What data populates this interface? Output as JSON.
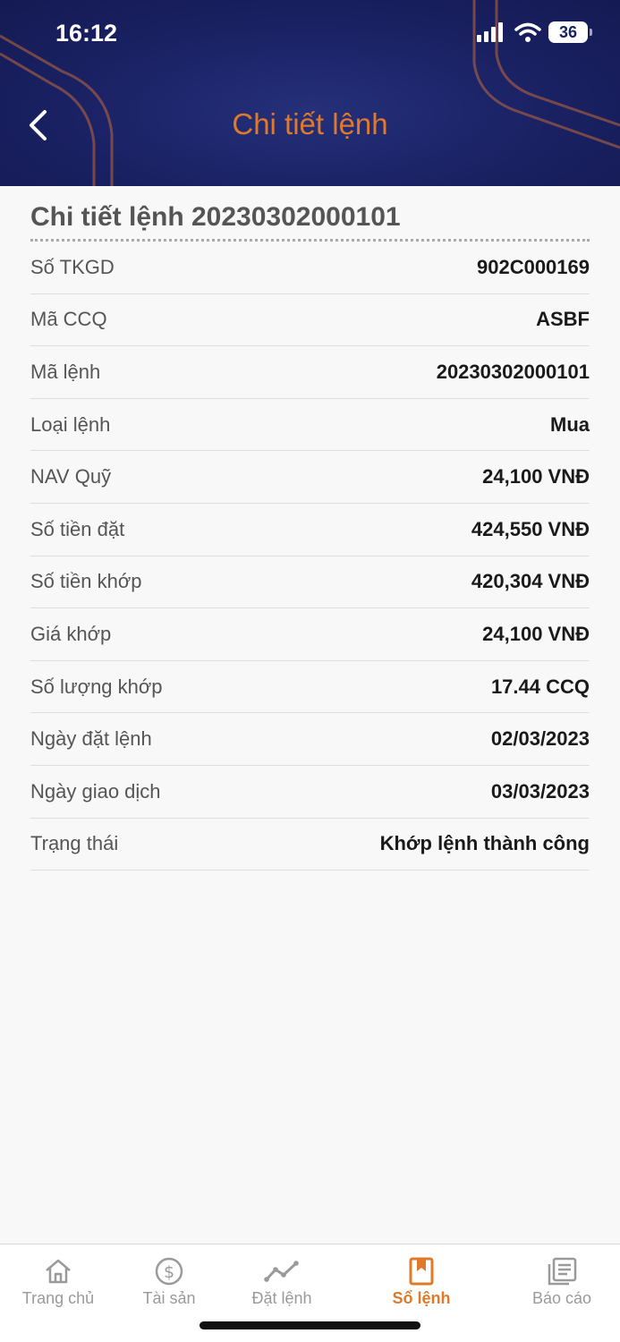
{
  "status": {
    "time": "16:12",
    "battery": "36"
  },
  "header": {
    "title": "Chi tiết lệnh"
  },
  "section": {
    "title": "Chi tiết lệnh 20230302000101"
  },
  "details": [
    {
      "label": "Số TKGD",
      "value": "902C000169"
    },
    {
      "label": "Mã CCQ",
      "value": "ASBF"
    },
    {
      "label": "Mã lệnh",
      "value": "20230302000101"
    },
    {
      "label": "Loại lệnh",
      "value": "Mua"
    },
    {
      "label": "NAV Quỹ",
      "value": "24,100 VNĐ"
    },
    {
      "label": "Số tiền đặt",
      "value": "424,550 VNĐ"
    },
    {
      "label": "Số tiền khớp",
      "value": "420,304 VNĐ"
    },
    {
      "label": "Giá khớp",
      "value": "24,100 VNĐ"
    },
    {
      "label": "Số lượng khớp",
      "value": "17.44 CCQ"
    },
    {
      "label": "Ngày đặt lệnh",
      "value": "02/03/2023"
    },
    {
      "label": "Ngày giao dịch",
      "value": "03/03/2023"
    },
    {
      "label": "Trạng thái",
      "value": "Khớp lệnh thành công"
    }
  ],
  "tabs": [
    {
      "label": "Trang chủ",
      "icon": "home-icon"
    },
    {
      "label": "Tài sản",
      "icon": "dollar-icon"
    },
    {
      "label": "Đặt lệnh",
      "icon": "chart-line-icon"
    },
    {
      "label": "Sổ lệnh",
      "icon": "bookmark-book-icon",
      "active": true
    },
    {
      "label": "Báo cáo",
      "icon": "report-icon"
    }
  ],
  "colors": {
    "accent": "#e07a2a",
    "header_bg": "#1a2163",
    "inactive": "#9a9a9a"
  }
}
